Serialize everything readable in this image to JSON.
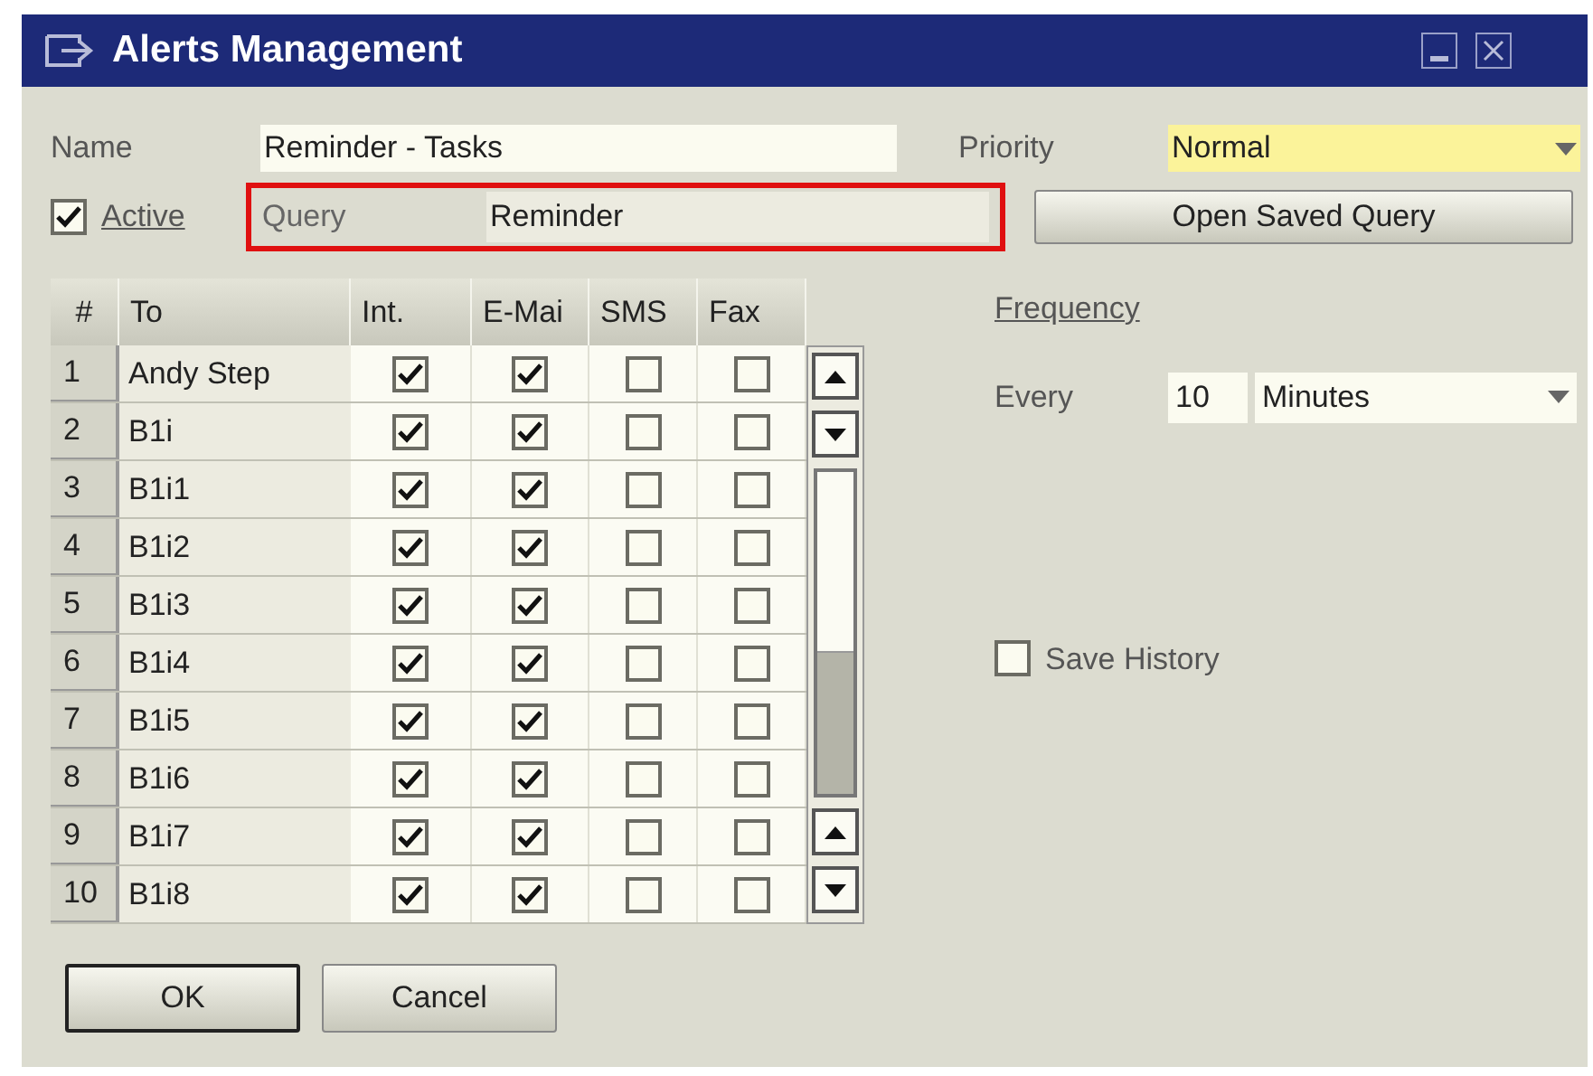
{
  "window": {
    "title": "Alerts Management"
  },
  "name": {
    "label": "Name",
    "value": "Reminder - Tasks"
  },
  "priority": {
    "label": "Priority",
    "value": "Normal"
  },
  "active": {
    "label": "Active",
    "checked": true
  },
  "query": {
    "label": "Query",
    "value": "Reminder",
    "highlighted": true
  },
  "open_saved_query": "Open Saved Query",
  "table": {
    "columns": [
      "#",
      "To",
      "Int.",
      "E-Mai",
      "SMS",
      "Fax"
    ],
    "rows": [
      {
        "num": "1",
        "to": "Andy Step",
        "int": true,
        "email": true,
        "sms": false,
        "fax": false
      },
      {
        "num": "2",
        "to": "B1i",
        "int": true,
        "email": true,
        "sms": false,
        "fax": false
      },
      {
        "num": "3",
        "to": "B1i1",
        "int": true,
        "email": true,
        "sms": false,
        "fax": false
      },
      {
        "num": "4",
        "to": "B1i2",
        "int": true,
        "email": true,
        "sms": false,
        "fax": false
      },
      {
        "num": "5",
        "to": "B1i3",
        "int": true,
        "email": true,
        "sms": false,
        "fax": false
      },
      {
        "num": "6",
        "to": "B1i4",
        "int": true,
        "email": true,
        "sms": false,
        "fax": false
      },
      {
        "num": "7",
        "to": "B1i5",
        "int": true,
        "email": true,
        "sms": false,
        "fax": false
      },
      {
        "num": "8",
        "to": "B1i6",
        "int": true,
        "email": true,
        "sms": false,
        "fax": false
      },
      {
        "num": "9",
        "to": "B1i7",
        "int": true,
        "email": true,
        "sms": false,
        "fax": false
      },
      {
        "num": "10",
        "to": "B1i8",
        "int": true,
        "email": true,
        "sms": false,
        "fax": false
      }
    ]
  },
  "frequency": {
    "heading": "Frequency",
    "label": "Every",
    "value": "10",
    "unit": "Minutes"
  },
  "save_history": {
    "label": "Save History",
    "checked": false
  },
  "buttons": [
    "OK",
    "Cancel"
  ]
}
